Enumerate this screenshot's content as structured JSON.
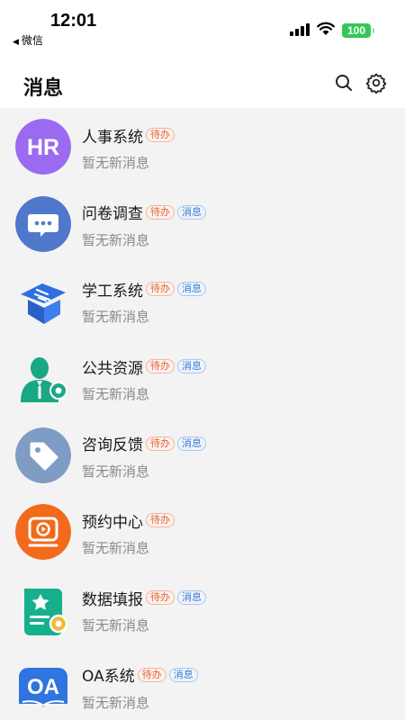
{
  "status_bar": {
    "time": "12:01",
    "back_app": "微信",
    "battery": "100"
  },
  "nav": {
    "title": "消息",
    "icons": [
      "search-icon",
      "settings-gear-icon"
    ]
  },
  "colors": {
    "todo_badge": "#e1663b",
    "msg_badge": "#3b7bd1",
    "subtitle": "#8a8a8a",
    "background": "#f3f3f3"
  },
  "messages": [
    {
      "title": "人事系统",
      "todo": "待办",
      "subtitle": "暂无新消息",
      "avatar_text": "HR",
      "icon": "hr-icon"
    },
    {
      "title": "问卷调查",
      "todo": "待办",
      "msg": "消息",
      "subtitle": "暂无新消息",
      "icon": "chat-bubble-icon"
    },
    {
      "title": "学工系统",
      "todo": "待办",
      "msg": "消息",
      "subtitle": "暂无新消息",
      "icon": "graduation-cap-icon"
    },
    {
      "title": "公共资源",
      "todo": "待办",
      "msg": "消息",
      "subtitle": "暂无新消息",
      "icon": "person-gear-icon"
    },
    {
      "title": "咨询反馈",
      "todo": "待办",
      "msg": "消息",
      "subtitle": "暂无新消息",
      "icon": "tag-icon"
    },
    {
      "title": "预约中心",
      "todo": "待办",
      "subtitle": "暂无新消息",
      "icon": "play-button-icon"
    },
    {
      "title": "数据填报",
      "todo": "待办",
      "msg": "消息",
      "subtitle": "暂无新消息",
      "icon": "form-star-icon"
    },
    {
      "title": "OA系统",
      "todo": "待办",
      "msg": "消息",
      "subtitle": "暂无新消息",
      "avatar_text": "OA",
      "icon": "oa-book-icon"
    }
  ]
}
